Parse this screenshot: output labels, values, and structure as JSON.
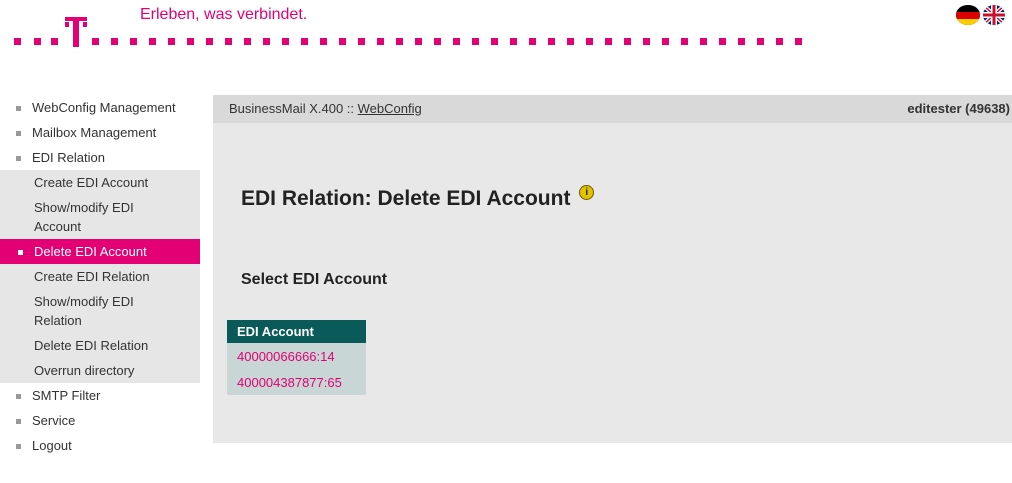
{
  "header": {
    "tagline": "Erleben, was verbindet.",
    "brand_color": "#e20074",
    "flags": [
      {
        "icon": "german-flag-icon"
      },
      {
        "icon": "uk-flag-icon"
      }
    ]
  },
  "sidebar": {
    "items": [
      {
        "label": "WebConfig Management",
        "level": "top"
      },
      {
        "label": "Mailbox Management",
        "level": "top"
      },
      {
        "label": "EDI Relation",
        "level": "top"
      },
      {
        "label": "Create EDI Account",
        "level": "sub"
      },
      {
        "label": "Show/modify EDI Account",
        "level": "sub"
      },
      {
        "label": "Delete EDI Account",
        "level": "active"
      },
      {
        "label": "Create EDI Relation",
        "level": "sub"
      },
      {
        "label": "Show/modify EDI Relation",
        "level": "sub"
      },
      {
        "label": "Delete EDI Relation",
        "level": "sub"
      },
      {
        "label": "Overrun directory",
        "level": "sub"
      },
      {
        "label": "SMTP Filter",
        "level": "top"
      },
      {
        "label": "Service",
        "level": "top"
      },
      {
        "label": "Logout",
        "level": "top"
      }
    ]
  },
  "content": {
    "breadcrumb_prefix": "BusinessMail X.400 :: ",
    "breadcrumb_link": "WebConfig",
    "user": "editester (49638)",
    "page_title": "EDI Relation: Delete EDI Account",
    "info_icon": "info-icon",
    "section_title": "Select EDI Account",
    "table": {
      "header": "EDI Account",
      "header_color": "#0a5a5a",
      "rows": [
        "40000066666:14",
        "400004387877:65"
      ]
    }
  }
}
